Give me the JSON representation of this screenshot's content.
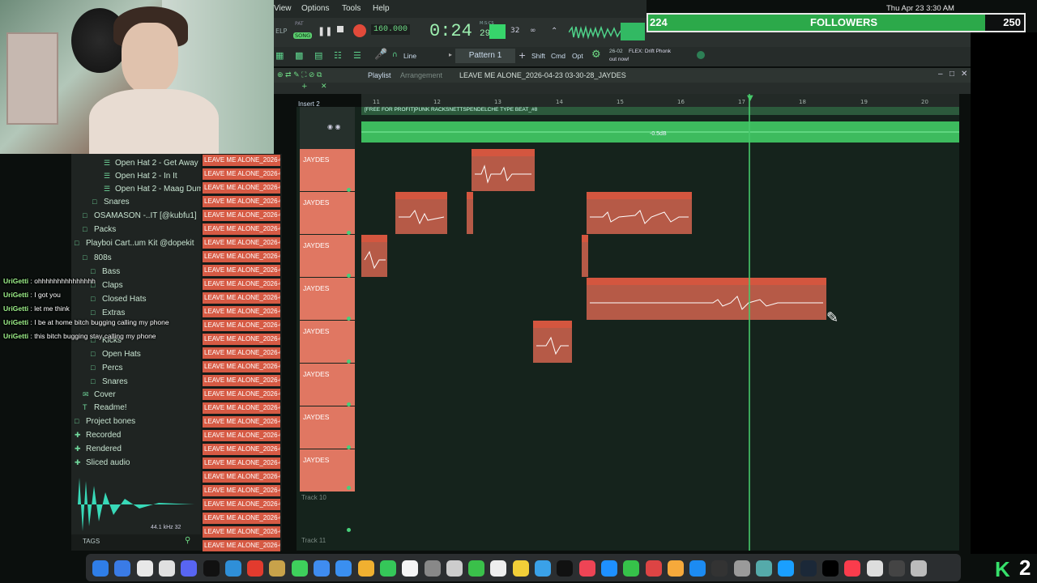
{
  "menu": {
    "items": [
      "View",
      "Options",
      "Tools",
      "Help"
    ]
  },
  "system": {
    "clock": "Thu Apr 23  3:30 AM"
  },
  "followers": {
    "current": "224",
    "label": "FOLLOWERS",
    "goal": "250",
    "progress_fraction": 0.896,
    "bar_color": "#2ca94a"
  },
  "transport": {
    "mode_left": "PAT",
    "mode_right": "SONG",
    "tempo": "160.000",
    "time": "0:24",
    "time_sub": "29",
    "time_label": "M:S:CS",
    "snap": "Line",
    "pattern": "Pattern 1",
    "keys": [
      "Shift",
      "Cmd",
      "Opt"
    ],
    "news_date": "26-02",
    "news_text": "FLEX: Drift Phonk",
    "news_sub": "out now!",
    "step_label": "32",
    "side_label": "ELP"
  },
  "playlist": {
    "title": "Playlist",
    "subtitle": "Arrangement",
    "project": "LEAVE ME ALONE_2026-04-23 03-30-28_JAYDES",
    "insert": "Insert 2",
    "ruler": [
      "11",
      "12",
      "13",
      "14",
      "15",
      "16",
      "17",
      "18",
      "19",
      "20"
    ],
    "gain_label": "-0.5dB",
    "beat_clip": "[FREE FOR PROFIT]PUNK RACKSNETTSPENDELCHE TYPE BEAT_#8"
  },
  "tracks": [
    {
      "name": "JAYDES"
    },
    {
      "name": "JAYDES"
    },
    {
      "name": "JAYDES"
    },
    {
      "name": "JAYDES"
    },
    {
      "name": "JAYDES"
    },
    {
      "name": "JAYDES"
    },
    {
      "name": "JAYDES"
    },
    {
      "name": "JAYDES"
    },
    {
      "name": "Track 10"
    },
    {
      "name": "Track 11"
    }
  ],
  "clips": [
    {
      "label": "LEAV..JAYDES"
    },
    {
      "label": "untitle..._JAYDES"
    },
    {
      "label": "LEAVE ME AL...5-41_JAYDE L..2"
    },
    {
      "label": "un..ES"
    },
    {
      "label": "LEAVE ME ALONE_2026-04-23 03-30-28_JAYDES"
    },
    {
      "label": "..S  LE..2"
    }
  ],
  "browser": {
    "items": [
      {
        "label": "Open Hat 2 - Get Away",
        "icon": "drum-icon"
      },
      {
        "label": "Open Hat 2 - In It",
        "icon": "drum-icon"
      },
      {
        "label": "Open Hat 2 - Maag Dump",
        "icon": "drum-icon"
      },
      {
        "label": "Snares",
        "icon": "folder-icon"
      },
      {
        "label": "OSAMASON -..IT [@kubfu1]",
        "icon": "folder-icon"
      },
      {
        "label": "Packs",
        "icon": "folder-icon"
      },
      {
        "label": "Playboi Cart..um Kit @dopekit",
        "icon": "folder-icon"
      },
      {
        "label": "808s",
        "icon": "folder-icon"
      },
      {
        "label": "Bass",
        "icon": "folder-icon"
      },
      {
        "label": "Claps",
        "icon": "folder-icon"
      },
      {
        "label": "Closed Hats",
        "icon": "folder-icon"
      },
      {
        "label": "Extras",
        "icon": "folder-icon"
      },
      {
        "label": "Kicks",
        "icon": "folder-icon"
      },
      {
        "label": "Open Hats",
        "icon": "folder-icon"
      },
      {
        "label": "Percs",
        "icon": "folder-icon"
      },
      {
        "label": "Snares",
        "icon": "folder-icon"
      },
      {
        "label": "Cover",
        "icon": "image-icon"
      },
      {
        "label": "Readme!",
        "icon": "text-icon"
      },
      {
        "label": "Project bones",
        "icon": "folder-icon"
      },
      {
        "label": "Recorded",
        "icon": "plus-icon"
      },
      {
        "label": "Rendered",
        "icon": "plus-icon"
      },
      {
        "label": "Sliced audio",
        "icon": "plus-icon"
      }
    ],
    "sample_info": "44.1 kHz 32",
    "tags_label": "TAGS"
  },
  "cliplist": {
    "label": "LEAVE ME ALONE_2026-0..."
  },
  "chat": [
    {
      "user": "UriGetti",
      "text": "ohhhhhhhhhhhhhhh"
    },
    {
      "user": "UriGetti",
      "text": "I got you"
    },
    {
      "user": "UriGetti",
      "text": "let me think"
    },
    {
      "user": "UriGetti",
      "text": "I be at home bitch bugging calling my phone"
    },
    {
      "user": "UriGetti",
      "text": "this bitch bugging stay calling my phone"
    }
  ],
  "stream": {
    "kick_digit": "2"
  }
}
